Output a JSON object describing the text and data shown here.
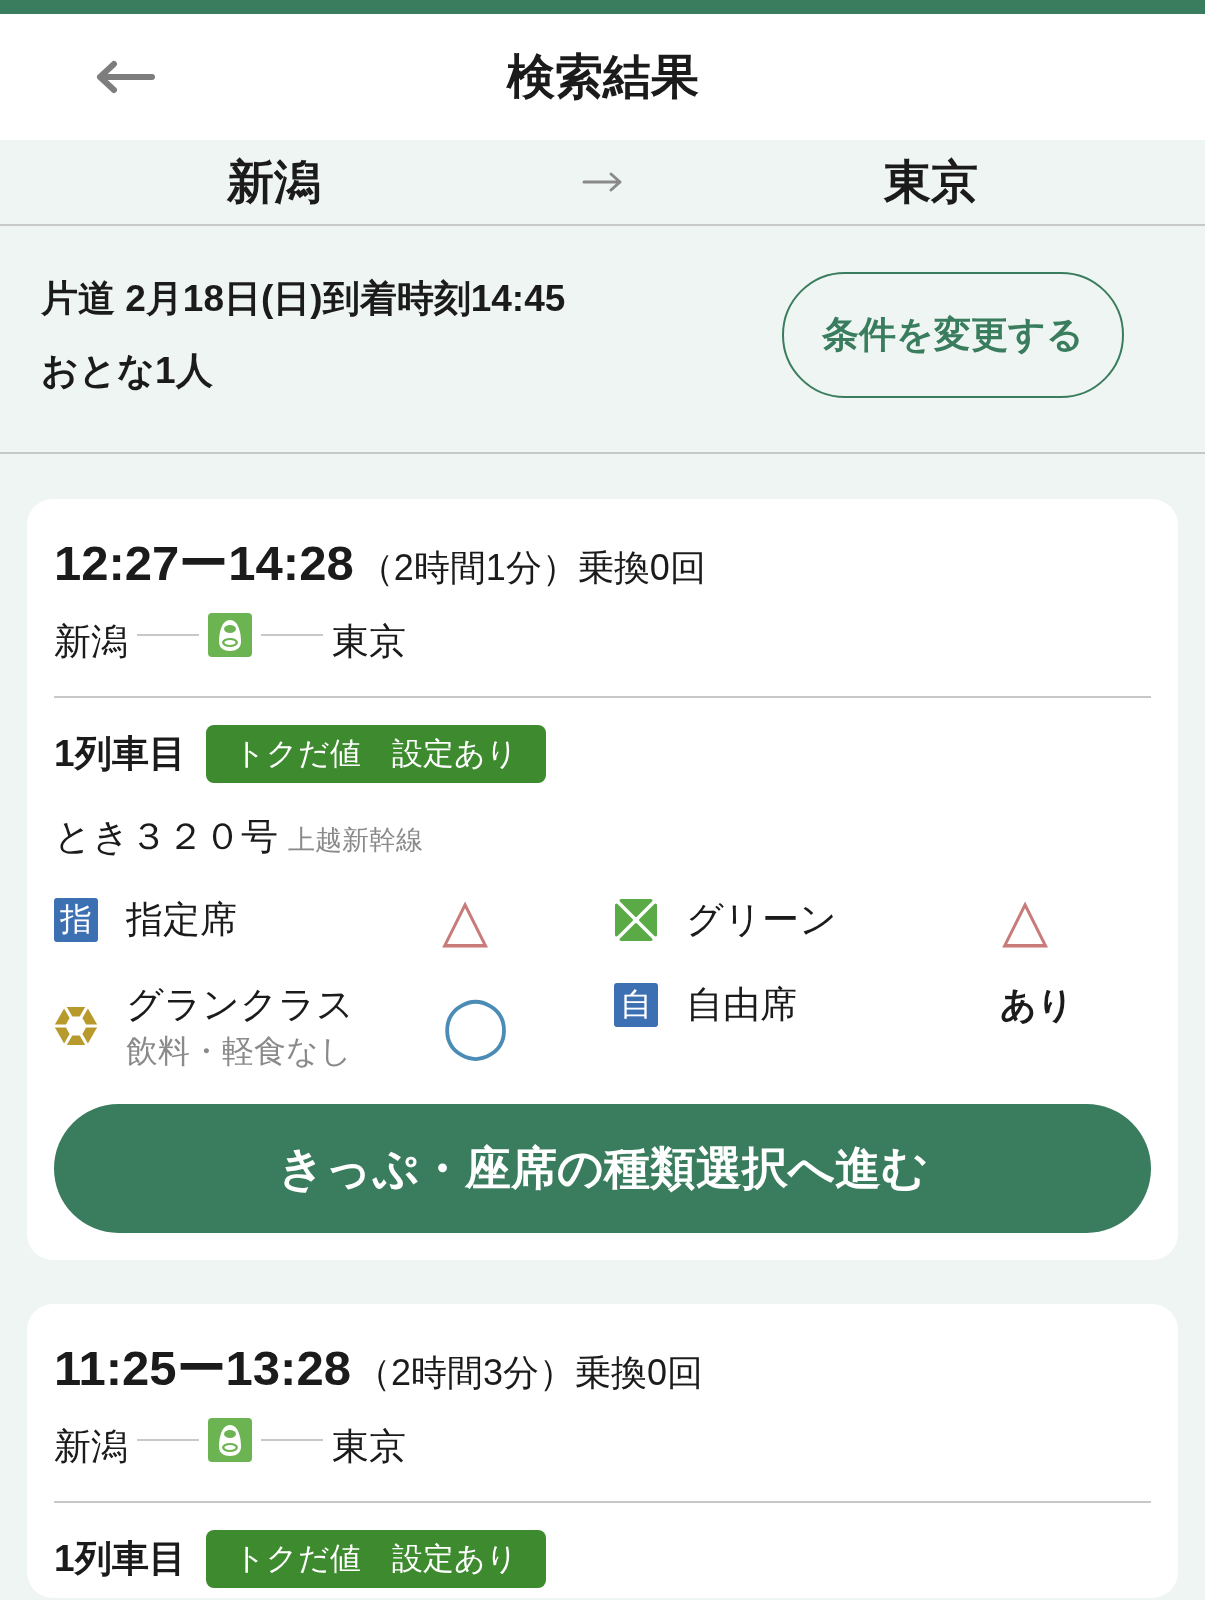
{
  "header": {
    "title": "検索結果"
  },
  "route": {
    "from": "新潟",
    "to": "東京"
  },
  "conditions": {
    "lines": [
      "片道 2月18日(日)到着時刻14:45",
      "おとな1人"
    ],
    "button": "条件を変更する"
  },
  "results": [
    {
      "times": "12:27ー14:28",
      "duration": "（2時間1分）",
      "transfers": "乗換0回",
      "from": "新潟",
      "to": "東京",
      "trains": [
        {
          "order": "1列車目",
          "badge": "トクだ値　設定あり",
          "name": "とき３２０号",
          "line": "上越新幹線",
          "seats": [
            {
              "kind": "tile",
              "icon_text": "指",
              "label": "指定席",
              "availability": "△",
              "color": "#c97b7b"
            },
            {
              "kind": "clover",
              "label": "グリーン",
              "availability": "△",
              "color": "#c97b7b"
            },
            {
              "kind": "emblem",
              "label": "グランクラス",
              "note": "飲料・軽食なし",
              "availability": "◯",
              "color": "#4a8cb5"
            },
            {
              "kind": "tile",
              "icon_text": "自",
              "label": "自由席",
              "availability": "あり",
              "color": "#1b1b1b"
            }
          ]
        }
      ],
      "button": "きっぷ・座席の種類選択へ進む"
    },
    {
      "times": "11:25ー13:28",
      "duration": "（2時間3分）",
      "transfers": "乗換0回",
      "from": "新潟",
      "to": "東京",
      "trains": [
        {
          "order": "1列車目",
          "badge": "トクだ値　設定あり"
        }
      ]
    }
  ]
}
